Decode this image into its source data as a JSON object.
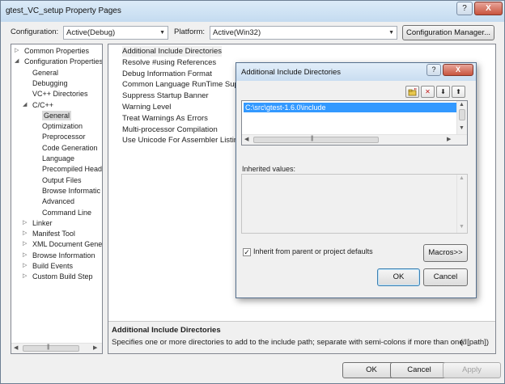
{
  "window": {
    "title": "gtest_VC_setup Property Pages",
    "help_glyph": "?",
    "close_glyph": "X"
  },
  "toolbar": {
    "configuration_label": "Configuration:",
    "configuration_value": "Active(Debug)",
    "platform_label": "Platform:",
    "platform_value": "Active(Win32)",
    "config_manager_label": "Configuration Manager..."
  },
  "tree": {
    "items": [
      {
        "label": "Common Properties",
        "arrow": "▷"
      },
      {
        "label": "Configuration Properties",
        "arrow": "◢"
      },
      {
        "label": "General",
        "arrow": ""
      },
      {
        "label": "Debugging",
        "arrow": ""
      },
      {
        "label": "VC++ Directories",
        "arrow": ""
      },
      {
        "label": "C/C++",
        "arrow": "◢"
      },
      {
        "label": "General",
        "arrow": ""
      },
      {
        "label": "Optimization",
        "arrow": ""
      },
      {
        "label": "Preprocessor",
        "arrow": ""
      },
      {
        "label": "Code Generation",
        "arrow": ""
      },
      {
        "label": "Language",
        "arrow": ""
      },
      {
        "label": "Precompiled Head",
        "arrow": ""
      },
      {
        "label": "Output Files",
        "arrow": ""
      },
      {
        "label": "Browse Informatic",
        "arrow": ""
      },
      {
        "label": "Advanced",
        "arrow": ""
      },
      {
        "label": "Command Line",
        "arrow": ""
      },
      {
        "label": "Linker",
        "arrow": "▷"
      },
      {
        "label": "Manifest Tool",
        "arrow": "▷"
      },
      {
        "label": "XML Document Gene",
        "arrow": "▷"
      },
      {
        "label": "Browse Information",
        "arrow": "▷"
      },
      {
        "label": "Build Events",
        "arrow": "▷"
      },
      {
        "label": "Custom Build Step",
        "arrow": "▷"
      }
    ]
  },
  "properties": {
    "items": [
      "Additional Include Directories",
      "Resolve #using References",
      "Debug Information Format",
      "Common Language RunTime Support",
      "Suppress Startup Banner",
      "Warning Level",
      "Treat Warnings As Errors",
      "Multi-processor Compilation",
      "Use Unicode For Assembler Listing"
    ],
    "description_title": "Additional Include Directories",
    "description_text": "Specifies one or more directories to add to the include path; separate with semi-colons if more than one.",
    "description_switch": "(/I[path])"
  },
  "buttons": {
    "ok": "OK",
    "cancel": "Cancel",
    "apply": "Apply"
  },
  "dialog": {
    "title": "Additional Include Directories",
    "help_glyph": "?",
    "close_glyph": "X",
    "entry": "C:\\src\\gtest-1.6.0\\include",
    "inherited_label": "Inherited values:",
    "inherit_checkbox_label": "Inherit from parent or project defaults",
    "inherit_checked": true,
    "macros_label": "Macros>>",
    "ok_label": "OK",
    "cancel_label": "Cancel",
    "tool_new_icon": "folder-new-icon",
    "tool_delete_icon": "delete-icon",
    "tool_down_icon": "arrow-down-icon",
    "tool_up_icon": "arrow-up-icon"
  }
}
